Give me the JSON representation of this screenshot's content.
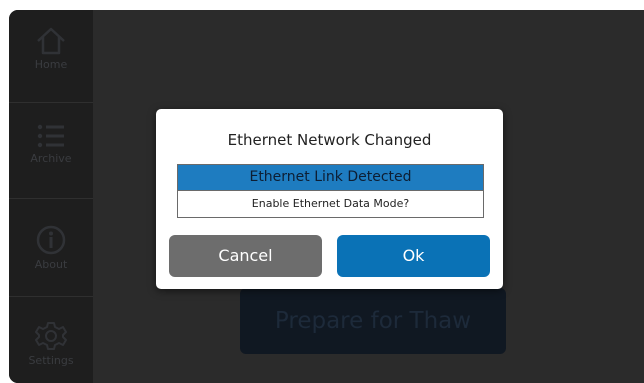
{
  "sidebar": {
    "items": [
      {
        "label": "Home",
        "icon": "home-icon"
      },
      {
        "label": "Archive",
        "icon": "list-icon"
      },
      {
        "label": "About",
        "icon": "info-icon"
      },
      {
        "label": "Settings",
        "icon": "gear-icon"
      }
    ]
  },
  "main": {
    "primary_button": "Prepare for Thaw"
  },
  "dialog": {
    "title": "Ethernet Network Changed",
    "status": "Ethernet Link Detected",
    "question": "Enable Ethernet Data Mode?",
    "cancel_label": "Cancel",
    "ok_label": "Ok"
  },
  "colors": {
    "accent": "#0a72b6",
    "status_bar": "#1e7cc0",
    "cancel": "#6d6d6d"
  }
}
